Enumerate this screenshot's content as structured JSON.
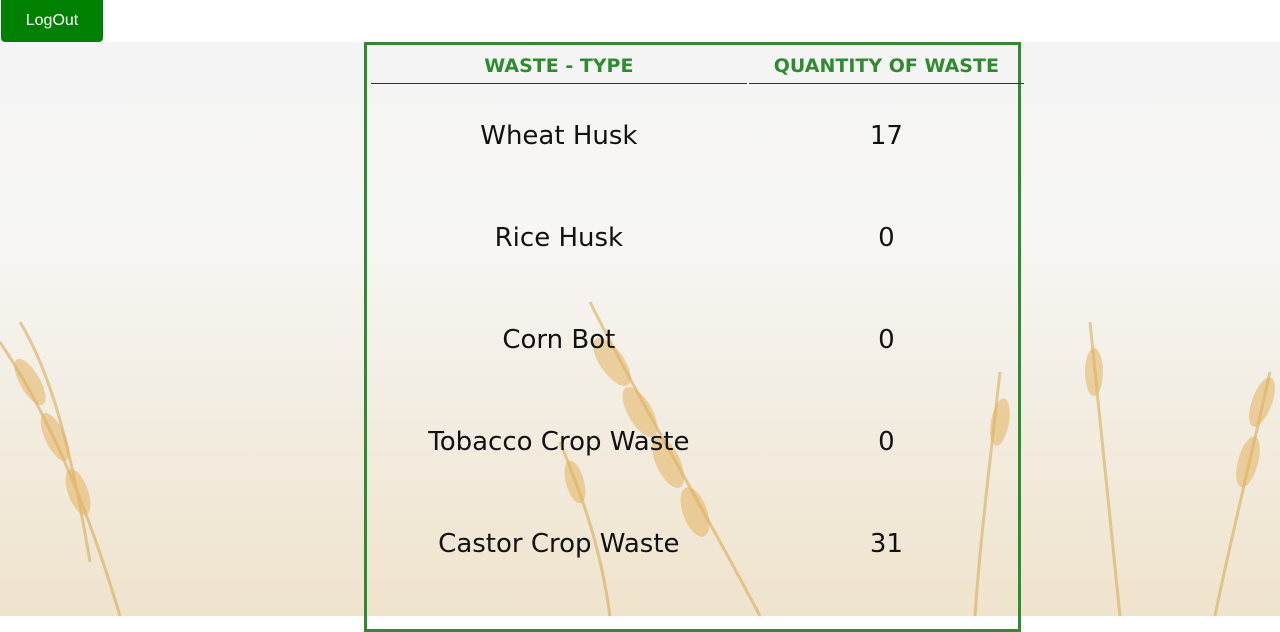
{
  "header": {
    "logout_label": "LogOut"
  },
  "table": {
    "columns": [
      "WASTE - TYPE",
      "QUANTITY OF WASTE"
    ],
    "rows": [
      {
        "type": "Wheat Husk",
        "quantity": "17"
      },
      {
        "type": "Rice Husk",
        "quantity": "0"
      },
      {
        "type": "Corn Bot",
        "quantity": "0"
      },
      {
        "type": "Tobacco Crop Waste",
        "quantity": "0"
      },
      {
        "type": "Castor Crop Waste",
        "quantity": "31"
      }
    ]
  },
  "colors": {
    "button_green": "#008000",
    "accent_green": "#2e8b2e"
  }
}
